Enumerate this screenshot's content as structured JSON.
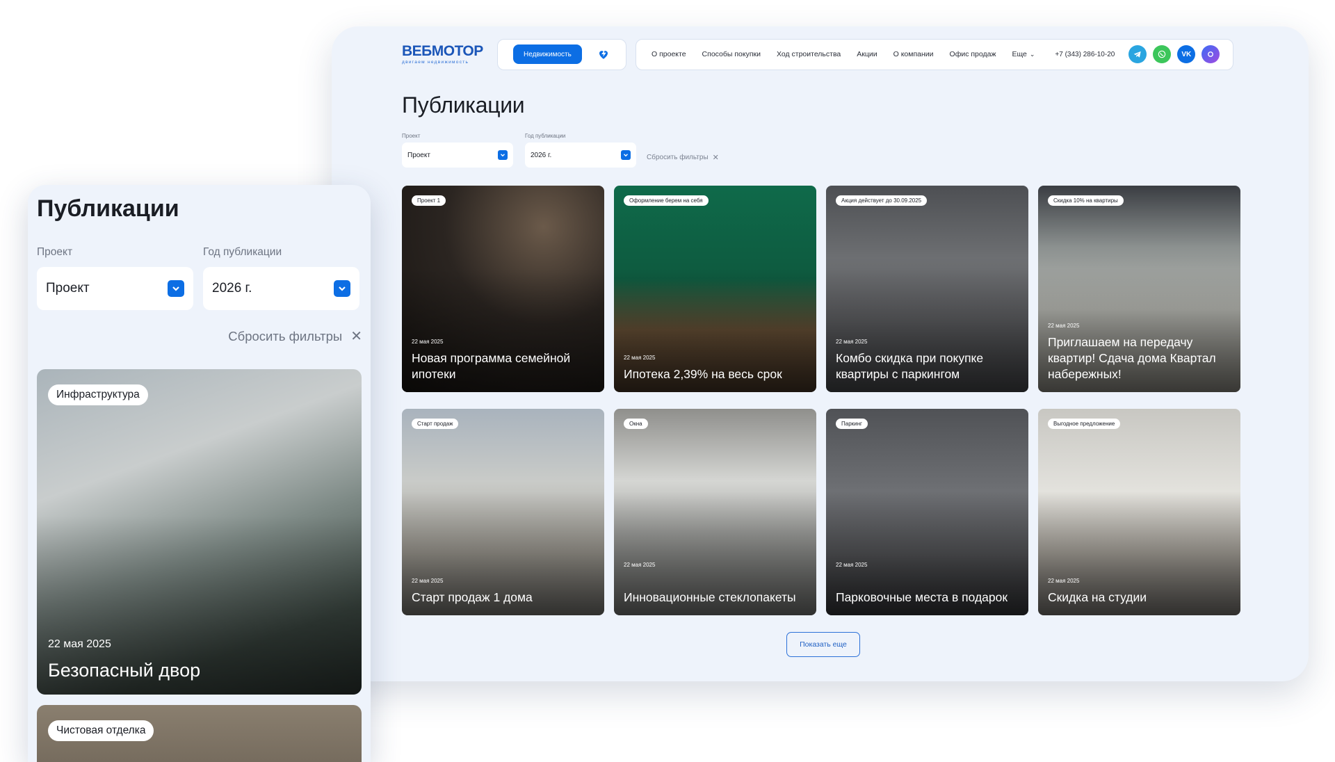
{
  "desktop": {
    "logo": {
      "name": "ВЕБМОТОР",
      "tagline": "двигаем недвижимость"
    },
    "header": {
      "realty_button": "Недвижимость",
      "nav": [
        "О проекте",
        "Способы покупки",
        "Ход строительства",
        "Акции",
        "О компании",
        "Офис продаж"
      ],
      "more": "Еще",
      "phone": "+7 (343) 286-10-20",
      "socials": [
        "telegram-icon",
        "whatsapp-icon",
        "vk-icon",
        "max-icon"
      ]
    },
    "page_title": "Публикации",
    "filters": {
      "project_label": "Проект",
      "project_value": "Проект",
      "year_label": "Год публикации",
      "year_value": "2026 г.",
      "reset": "Сбросить фильтры"
    },
    "cards": [
      {
        "badge": "Проект 1",
        "date": "22 мая 2025",
        "title": "Новая программа семейной ипотеки"
      },
      {
        "badge": "Оформление берем на себя",
        "date": "22 мая 2025",
        "title": "Ипотека 2,39% на весь срок"
      },
      {
        "badge": "Акция действует до 30.09.2025",
        "date": "22 мая 2025",
        "title": "Комбо скидка при покупке квартиры с паркингом"
      },
      {
        "badge": "Скидка 10% на квартиры",
        "date": "22 мая 2025",
        "title": "Приглашаем на передачу квартир! Сдача дома Квартал набережных!"
      },
      {
        "badge": "Старт продаж",
        "date": "22 мая 2025",
        "title": "Старт продаж 1 дома"
      },
      {
        "badge": "Окна",
        "date": "22 мая 2025",
        "title": "Инновационные стеклопакеты"
      },
      {
        "badge": "Паркинг",
        "date": "22 мая 2025",
        "title": "Парковочные места в подарок"
      },
      {
        "badge": "Выгодное предложение",
        "date": "22 мая 2025",
        "title": "Скидка на студии"
      }
    ],
    "show_more": "Показать еще"
  },
  "mobile": {
    "page_title": "Публикации",
    "project_label": "Проект",
    "project_value": "Проект",
    "year_label": "Год публикации",
    "year_value": "2026 г.",
    "reset": "Сбросить фильтры",
    "cards": [
      {
        "badge": "Инфраструктура",
        "date": "22 мая 2025",
        "title": "Безопасный двор"
      },
      {
        "badge": "Чистовая отделка"
      }
    ]
  },
  "colors": {
    "accent": "#0c6ee4",
    "background": "#eef3fb",
    "brand": "#1b56b8"
  }
}
